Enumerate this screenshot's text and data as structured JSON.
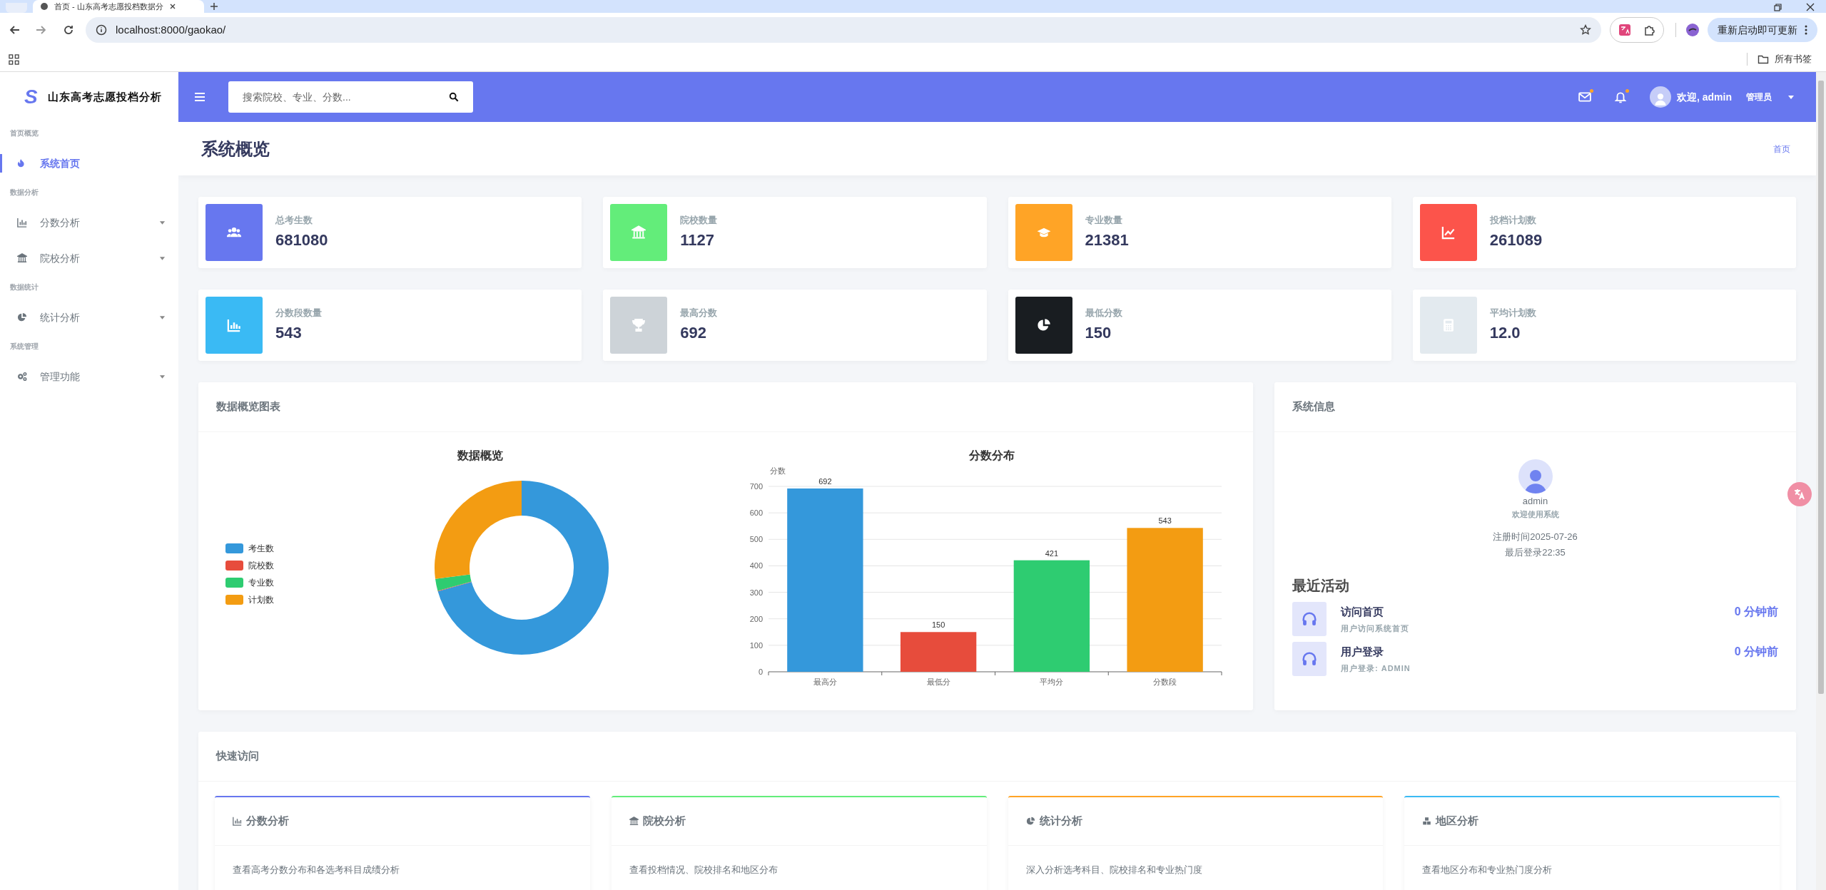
{
  "browser": {
    "tab_title": "首页 - 山东高考志愿投档数据分",
    "url": "localhost:8000/gaokao/",
    "update_button": "重新启动即可更新",
    "bookmarks_label": "所有书签"
  },
  "sidebar": {
    "logo": "S",
    "title": "山东高考志愿投档分析",
    "sections": [
      {
        "heading": "首页概览",
        "items": [
          {
            "label": "系统首页",
            "selected": true,
            "expandable": false
          }
        ]
      },
      {
        "heading": "数据分析",
        "items": [
          {
            "label": "分数分析",
            "selected": false,
            "expandable": true
          },
          {
            "label": "院校分析",
            "selected": false,
            "expandable": true
          }
        ]
      },
      {
        "heading": "数据统计",
        "items": [
          {
            "label": "统计分析",
            "selected": false,
            "expandable": true
          }
        ]
      },
      {
        "heading": "系统管理",
        "items": [
          {
            "label": "管理功能",
            "selected": false,
            "expandable": true
          }
        ]
      }
    ]
  },
  "header": {
    "search": {
      "placeholder": "搜索院校、专业、分数..."
    },
    "mail_unread": true,
    "bell_unread": true,
    "greeting": "欢迎, admin",
    "role": "管理员"
  },
  "page": {
    "title": "系统概览",
    "breadcrumb": "首页"
  },
  "stats": [
    {
      "label": "总考生数",
      "value": "681080",
      "color": "#6777ef"
    },
    {
      "label": "院校数量",
      "value": "1127",
      "color": "#63ed7a"
    },
    {
      "label": "专业数量",
      "value": "21381",
      "color": "#ffa426"
    },
    {
      "label": "投档计划数",
      "value": "261089",
      "color": "#fc544b"
    },
    {
      "label": "分数段数量",
      "value": "543",
      "color": "#3abaf4"
    },
    {
      "label": "最高分数",
      "value": "692",
      "color": "#cdd3d8"
    },
    {
      "label": "最低分数",
      "value": "150",
      "color": "#191d21"
    },
    {
      "label": "平均计划数",
      "value": "12.0",
      "color": "#e3eaef"
    }
  ],
  "chart_panel": {
    "title": "数据概览图表",
    "charts": [
      {
        "chart_data": {
          "type": "donut",
          "title": "数据概览",
          "categories": [
            "考生数",
            "院校数",
            "专业数",
            "计划数"
          ],
          "values": [
            70.6,
            0.12,
            2.22,
            27.06
          ],
          "colors": [
            "#3498db",
            "#e74c3c",
            "#2ecc71",
            "#f39c12"
          ],
          "legend": true
        }
      },
      {
        "chart_data": {
          "type": "bar",
          "title": "分数分布",
          "ylabel": "分数",
          "categories": [
            "最高分",
            "最低分",
            "平均分",
            "分数段"
          ],
          "values": [
            692,
            150,
            421,
            543
          ],
          "colors": [
            "#3498db",
            "#e74c3c",
            "#2ecc71",
            "#f39c12"
          ],
          "ylim": [
            0,
            700
          ],
          "yticks": [
            0,
            100,
            200,
            300,
            400,
            500,
            600,
            700
          ],
          "grid": true,
          "data_labels": true
        }
      }
    ]
  },
  "system_info": {
    "title": "系统信息",
    "username": "admin",
    "welcome": "欢迎使用系统",
    "registered": "注册时间2025-07-26",
    "last_login": "最后登录22:35",
    "activity_title": "最近活动",
    "activities": [
      {
        "title": "访问首页",
        "detail": "用户访问系统首页",
        "time": "0 分钟前"
      },
      {
        "title": "用户登录",
        "detail": "用户登录: ADMIN",
        "time": "0 分钟前"
      }
    ]
  },
  "quick_access": {
    "title": "快速访问",
    "cards": [
      {
        "title": "分数分析",
        "description": "查看高考分数分布和各选考科目成绩分析",
        "color": "#6777ef"
      },
      {
        "title": "院校分析",
        "description": "查看投档情况、院校排名和地区分布",
        "color": "#63ed7a"
      },
      {
        "title": "统计分析",
        "description": "深入分析选考科目、院校排名和专业热门度",
        "color": "#ffa426"
      },
      {
        "title": "地区分析",
        "description": "查看地区分布和专业热门度分析",
        "color": "#3abaf4"
      }
    ]
  }
}
